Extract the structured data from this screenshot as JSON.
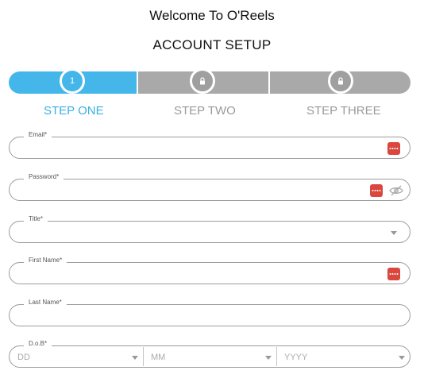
{
  "header": {
    "welcome": "Welcome To O'Reels",
    "setup": "ACCOUNT SETUP"
  },
  "steps": [
    {
      "label": "STEP ONE",
      "number": "1",
      "state": "active",
      "color": "#45b6ea"
    },
    {
      "label": "STEP TWO",
      "state": "locked",
      "icon": "lock-icon"
    },
    {
      "label": "STEP THREE",
      "state": "locked",
      "icon": "lock-icon"
    }
  ],
  "form": {
    "email": {
      "label": "Email*",
      "value": ""
    },
    "password": {
      "label": "Password*",
      "value": ""
    },
    "title": {
      "label": "Title*",
      "value": ""
    },
    "first_name": {
      "label": "First Name*",
      "value": ""
    },
    "last_name": {
      "label": "Last Name*",
      "value": ""
    },
    "dob": {
      "label": "D.o.B*",
      "day_placeholder": "DD",
      "month_placeholder": "MM",
      "year_placeholder": "YYYY"
    }
  },
  "colors": {
    "accent": "#45b6ea",
    "inactive": "#a9a9a9",
    "password_manager": "#d9473f"
  }
}
